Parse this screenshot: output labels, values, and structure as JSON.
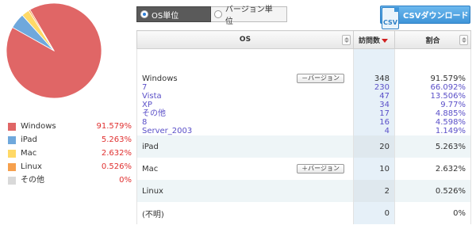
{
  "chart_data": {
    "type": "pie",
    "categories": [
      "Windows",
      "iPad",
      "Mac",
      "Linux",
      "その他"
    ],
    "values": [
      91.579,
      5.263,
      2.632,
      0.526,
      0
    ],
    "colors": [
      "#e06666",
      "#6fa8dc",
      "#ffd966",
      "#f6a04d",
      "#d9d9d9"
    ]
  },
  "legend": [
    {
      "name": "Windows",
      "pct": "91.579%",
      "color": "#e06666"
    },
    {
      "name": "iPad",
      "pct": "5.263%",
      "color": "#6fa8dc"
    },
    {
      "name": "Mac",
      "pct": "2.632%",
      "color": "#ffd966"
    },
    {
      "name": "Linux",
      "pct": "0.526%",
      "color": "#f6a04d"
    },
    {
      "name": "その他",
      "pct": "0%",
      "color": "#d9d9d9"
    }
  ],
  "toggle": {
    "os_label": "OS単位",
    "version_label": "バージョン単位"
  },
  "csv": {
    "icon_text": "CSV",
    "label": "CSVダウンロード"
  },
  "table": {
    "headers": {
      "os": "OS",
      "visits": "訪問数",
      "ratio": "割合"
    },
    "collapse_label": "－バージョン",
    "expand_label": "＋バージョン",
    "windows": {
      "name": "Windows",
      "visits": "348",
      "ratio": "91.579%",
      "versions": [
        {
          "name": "7",
          "visits": "230",
          "ratio": "66.092%"
        },
        {
          "name": "Vista",
          "visits": "47",
          "ratio": "13.506%"
        },
        {
          "name": "XP",
          "visits": "34",
          "ratio": "9.77%"
        },
        {
          "name": "その他",
          "visits": "17",
          "ratio": "4.885%"
        },
        {
          "name": "8",
          "visits": "16",
          "ratio": "4.598%"
        },
        {
          "name": "Server_2003",
          "visits": "4",
          "ratio": "1.149%"
        }
      ]
    },
    "rows": [
      {
        "name": "iPad",
        "visits": "20",
        "ratio": "5.263%"
      },
      {
        "name": "Mac",
        "visits": "10",
        "ratio": "2.632%"
      },
      {
        "name": "Linux",
        "visits": "2",
        "ratio": "0.526%"
      },
      {
        "name": "(不明)",
        "visits": "0",
        "ratio": "0%"
      }
    ]
  }
}
